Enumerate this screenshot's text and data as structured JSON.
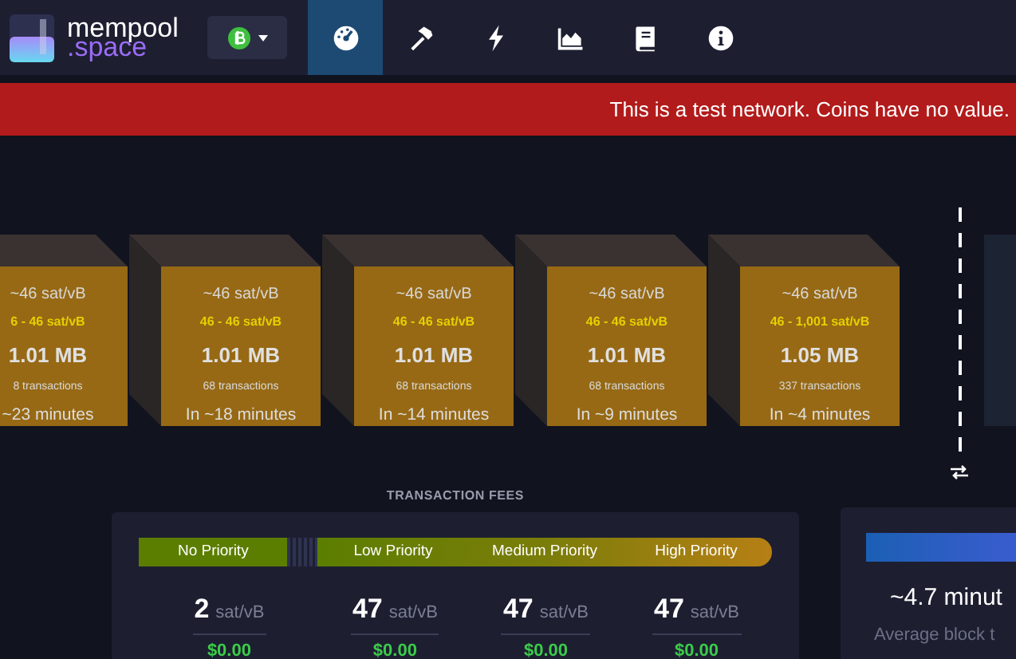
{
  "header": {
    "logo": {
      "line_1": "mempool",
      "line_2": ".space"
    },
    "nav": [
      {
        "kind": "dashboard",
        "selected": true
      },
      {
        "kind": "mining",
        "selected": false
      },
      {
        "kind": "lightning",
        "selected": false
      },
      {
        "kind": "graphs",
        "selected": false
      },
      {
        "kind": "docs",
        "selected": false
      },
      {
        "kind": "about",
        "selected": false
      }
    ]
  },
  "banner": "This is a test network. Coins have no value.",
  "blocks": [
    {
      "median_fee": "~46 sat/vB",
      "fee_range": "6 - 46 sat/vB",
      "size": "1.01 MB",
      "transactions": "8 transactions",
      "eta": "~23 minutes"
    },
    {
      "median_fee": "~46 sat/vB",
      "fee_range": "46 - 46 sat/vB",
      "size": "1.01 MB",
      "transactions": "68 transactions",
      "eta": "In ~18 minutes"
    },
    {
      "median_fee": "~46 sat/vB",
      "fee_range": "46 - 46 sat/vB",
      "size": "1.01 MB",
      "transactions": "68 transactions",
      "eta": "In ~14 minutes"
    },
    {
      "median_fee": "~46 sat/vB",
      "fee_range": "46 - 46 sat/vB",
      "size": "1.01 MB",
      "transactions": "68 transactions",
      "eta": "In ~9 minutes"
    },
    {
      "median_fee": "~46 sat/vB",
      "fee_range": "46 - 1,001 sat/vB",
      "size": "1.05 MB",
      "transactions": "337 transactions",
      "eta": "In ~4 minutes"
    }
  ],
  "transaction_fees": {
    "title": "TRANSACTION FEES",
    "tiers": [
      {
        "label": "No Priority",
        "value": "2",
        "unit": "sat/vB",
        "usd": "$0.00"
      },
      {
        "label": "Low Priority",
        "value": "47",
        "unit": "sat/vB",
        "usd": "$0.00"
      },
      {
        "label": "Medium Priority",
        "value": "47",
        "unit": "sat/vB",
        "usd": "$0.00"
      },
      {
        "label": "High Priority",
        "value": "47",
        "unit": "sat/vB",
        "usd": "$0.00"
      }
    ]
  },
  "difficulty": {
    "level": 1,
    "value": "~4.7 minut",
    "caption": "Average block t"
  }
}
